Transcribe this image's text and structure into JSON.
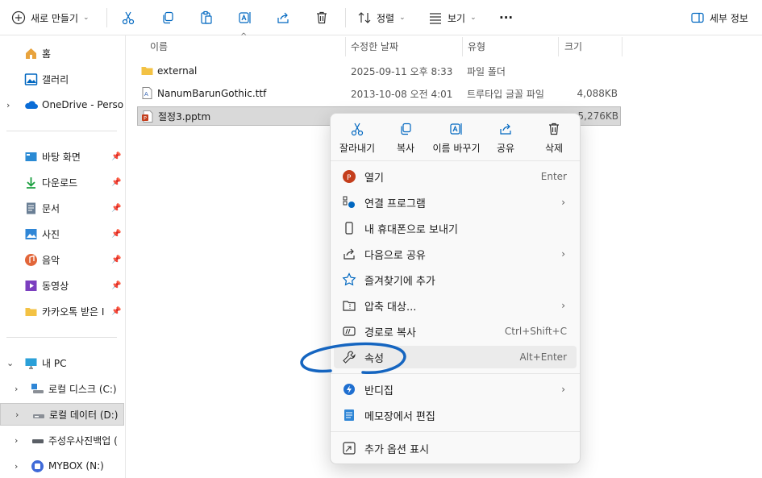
{
  "toolbar": {
    "new_label": "새로 만들기",
    "sort_label": "정렬",
    "view_label": "보기",
    "more_label": "···",
    "details_label": "세부 정보"
  },
  "columns": {
    "name": "이름",
    "modified": "수정한 날짜",
    "type": "유형",
    "size": "크기"
  },
  "files": [
    {
      "name": "external",
      "modified": "2025-09-11 오후 8:33",
      "type": "파일 폴더",
      "size": ""
    },
    {
      "name": "NanumBarunGothic.ttf",
      "modified": "2013-10-08 오전 4:01",
      "type": "트루타입 글꼴 파일",
      "size": "4,088KB"
    },
    {
      "name": "절정3.pptm",
      "modified": "",
      "type": "",
      "size": "5,276KB"
    }
  ],
  "sidebar": {
    "home": "홈",
    "gallery": "갤러리",
    "onedrive": "OneDrive - Persona",
    "desktop": "바탕 화면",
    "downloads": "다운로드",
    "documents": "문서",
    "pictures": "사진",
    "music": "음악",
    "videos": "동영상",
    "kakao": "카카오톡 받은 I",
    "thispc": "내 PC",
    "diskc": "로컬 디스크 (C:)",
    "diskd": "로컬 데이터 (D:)",
    "backup": "주성우사진백업 (",
    "mybox": "MYBOX (N:)"
  },
  "menu": {
    "quick": {
      "cut": "잘라내기",
      "copy": "복사",
      "rename": "이름 바꾸기",
      "share": "공유",
      "delete": "삭제"
    },
    "items": [
      {
        "label": "열기",
        "shortcut": "Enter"
      },
      {
        "label": "연결 프로그램",
        "shortcut": ""
      },
      {
        "label": "내 휴대폰으로 보내기",
        "shortcut": ""
      },
      {
        "label": "다음으로 공유",
        "shortcut": ""
      },
      {
        "label": "즐겨찾기에 추가",
        "shortcut": ""
      },
      {
        "label": "압축 대상...",
        "shortcut": ""
      },
      {
        "label": "경로로 복사",
        "shortcut": "Ctrl+Shift+C"
      },
      {
        "label": "속성",
        "shortcut": "Alt+Enter"
      },
      {
        "label": "반디집",
        "shortcut": ""
      },
      {
        "label": "메모장에서 편집",
        "shortcut": ""
      },
      {
        "label": "추가 옵션 표시",
        "shortcut": ""
      }
    ]
  },
  "colors": {
    "accent": "#0067c0",
    "annotation": "#1565c0",
    "ppt": "#c43e1c"
  }
}
